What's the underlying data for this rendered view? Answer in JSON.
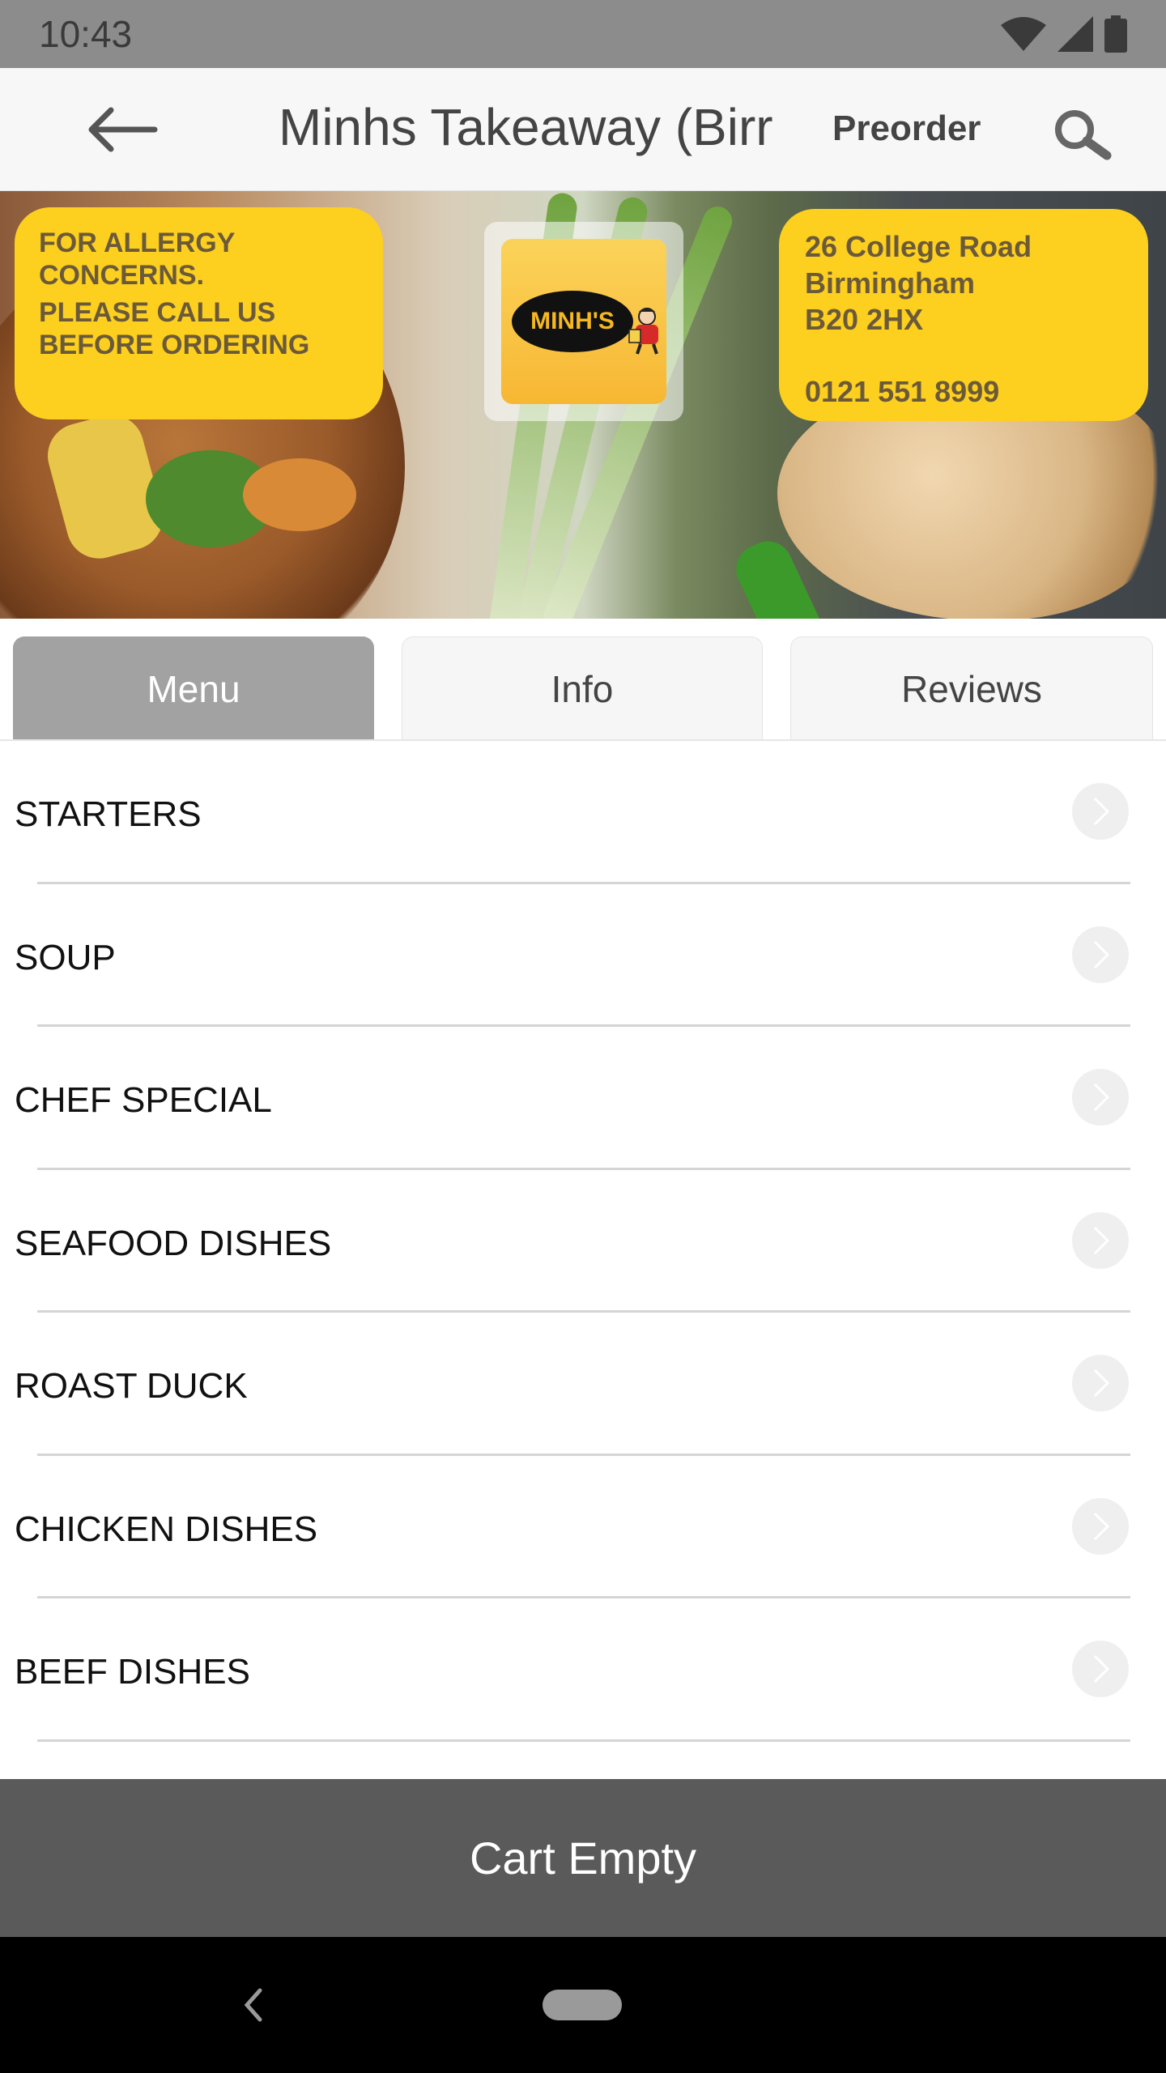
{
  "status_bar": {
    "time": "10:43"
  },
  "header": {
    "title": "Minhs Takeaway (Birr",
    "preorder_label": "Preorder",
    "back_icon": "arrow-left-icon",
    "search_icon": "search-icon"
  },
  "banner": {
    "allergy_notice": [
      "FOR ALLERGY",
      "CONCERNS.",
      "PLEASE CALL US",
      "BEFORE ORDERING"
    ],
    "address": [
      "26 College Road",
      "Birmingham",
      "B20 2HX"
    ],
    "phone": "0121 551 8999",
    "logo_text": "MINH'S"
  },
  "tabs": [
    {
      "label": "Menu",
      "active": true
    },
    {
      "label": "Info",
      "active": false
    },
    {
      "label": "Reviews",
      "active": false
    }
  ],
  "menu_items": [
    {
      "label": "STARTERS"
    },
    {
      "label": "SOUP"
    },
    {
      "label": "CHEF SPECIAL"
    },
    {
      "label": "SEAFOOD DISHES"
    },
    {
      "label": "ROAST DUCK"
    },
    {
      "label": "CHICKEN DISHES"
    },
    {
      "label": "BEEF DISHES"
    }
  ],
  "cart": {
    "label": "Cart Empty"
  },
  "colors": {
    "status_bar": "#8c8c8c",
    "banner_yellow": "#fdcf1f",
    "active_tab": "#a2a2a2",
    "cart_bar": "#5a5a5a"
  }
}
